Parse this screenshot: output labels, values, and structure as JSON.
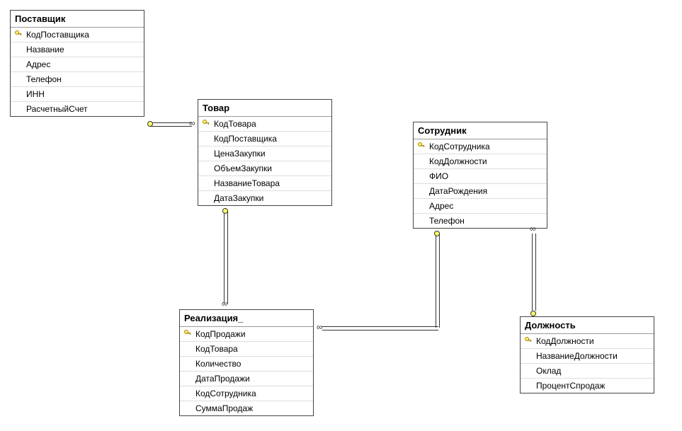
{
  "entities": {
    "supplier": {
      "title": "Поставщик",
      "fields": [
        {
          "name": "КодПоставщика",
          "pk": true
        },
        {
          "name": "Название",
          "pk": false
        },
        {
          "name": "Адрес",
          "pk": false
        },
        {
          "name": "Телефон",
          "pk": false
        },
        {
          "name": "ИНН",
          "pk": false
        },
        {
          "name": "РасчетныйСчет",
          "pk": false
        }
      ]
    },
    "product": {
      "title": "Товар",
      "fields": [
        {
          "name": "КодТовара",
          "pk": true
        },
        {
          "name": "КодПоставщика",
          "pk": false
        },
        {
          "name": "ЦенаЗакупки",
          "pk": false
        },
        {
          "name": "ОбъемЗакупки",
          "pk": false
        },
        {
          "name": "НазваниеТовара",
          "pk": false
        },
        {
          "name": "ДатаЗакупки",
          "pk": false
        }
      ]
    },
    "employee": {
      "title": "Сотрудник",
      "fields": [
        {
          "name": "КодСотрудника",
          "pk": true
        },
        {
          "name": "КодДолжности",
          "pk": false
        },
        {
          "name": "ФИО",
          "pk": false
        },
        {
          "name": "ДатаРождения",
          "pk": false
        },
        {
          "name": "Адрес",
          "pk": false
        },
        {
          "name": "Телефон",
          "pk": false
        }
      ]
    },
    "sale": {
      "title": "Реализация_",
      "fields": [
        {
          "name": "КодПродажи",
          "pk": true
        },
        {
          "name": "КодТовара",
          "pk": false
        },
        {
          "name": "Количество",
          "pk": false
        },
        {
          "name": "ДатаПродажи",
          "pk": false
        },
        {
          "name": "КодСотрудника",
          "pk": false
        },
        {
          "name": "СуммаПродаж",
          "pk": false
        }
      ]
    },
    "position": {
      "title": "Должность",
      "fields": [
        {
          "name": "КодДолжности",
          "pk": true
        },
        {
          "name": "НазваниеДолжности",
          "pk": false
        },
        {
          "name": "Оклад",
          "pk": false
        },
        {
          "name": "ПроцентСпродаж",
          "pk": false
        }
      ]
    }
  },
  "relationships": [
    {
      "from": "supplier",
      "to": "product",
      "type": "one-to-many"
    },
    {
      "from": "product",
      "to": "sale",
      "type": "one-to-many"
    },
    {
      "from": "employee",
      "to": "sale",
      "type": "one-to-many"
    },
    {
      "from": "position",
      "to": "employee",
      "type": "one-to-many"
    }
  ]
}
